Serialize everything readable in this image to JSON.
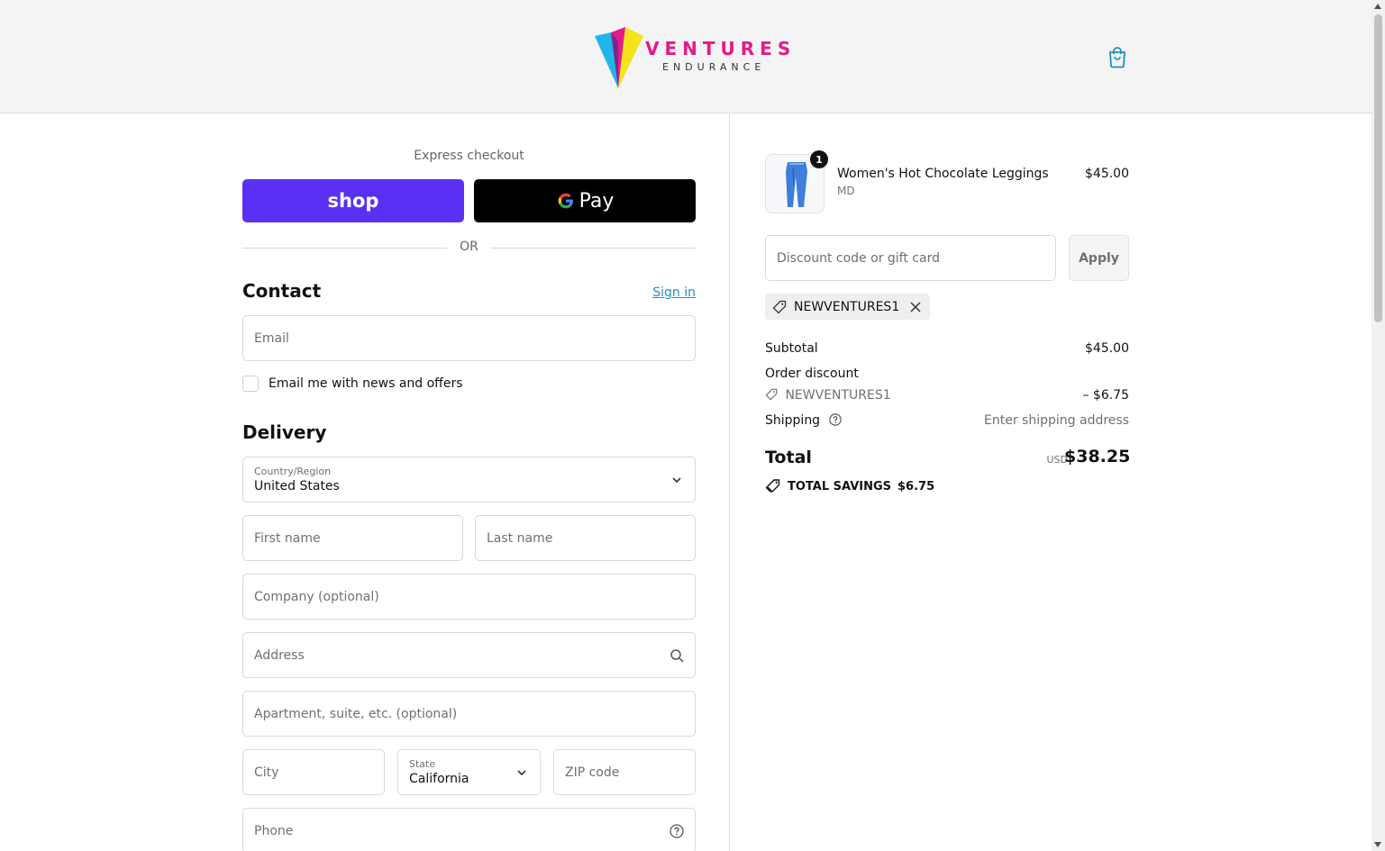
{
  "brand": {
    "name": "VENTURES",
    "tagline": "ENDURANCE",
    "colors": {
      "pink": "#e6198a",
      "yellow": "#f5e31a",
      "cyan": "#1fb6e8",
      "purple": "#5b2d90"
    }
  },
  "header": {
    "cart_icon": "shopping-bag-icon"
  },
  "express": {
    "label": "Express checkout",
    "shop_label": "shop",
    "gpay_label": "Pay",
    "or_label": "OR",
    "shop_color": "#5a31f4"
  },
  "contact": {
    "title": "Contact",
    "signin_label": "Sign in",
    "email_placeholder": "Email",
    "newsletter_label": "Email me with news and offers"
  },
  "delivery": {
    "title": "Delivery",
    "country_label": "Country/Region",
    "country_value": "United States",
    "first_name_placeholder": "First name",
    "last_name_placeholder": "Last name",
    "company_placeholder": "Company (optional)",
    "address_placeholder": "Address",
    "apartment_placeholder": "Apartment, suite, etc. (optional)",
    "city_placeholder": "City",
    "state_label": "State",
    "state_value": "California",
    "zip_placeholder": "ZIP code",
    "phone_placeholder": "Phone"
  },
  "order": {
    "item": {
      "quantity": "1",
      "name": "Women's Hot Chocolate Leggings",
      "variant": "MD",
      "price": "$45.00"
    },
    "discount_placeholder": "Discount code or gift card",
    "apply_label": "Apply",
    "applied_code": "NEWVENTURES1",
    "subtotal_label": "Subtotal",
    "subtotal_value": "$45.00",
    "order_discount_label": "Order discount",
    "discount_code": "NEWVENTURES1",
    "discount_value": "– $6.75",
    "shipping_label": "Shipping",
    "shipping_value": "Enter shipping address",
    "total_label": "Total",
    "total_currency": "USD",
    "total_value": "$38.25",
    "savings_label": "TOTAL SAVINGS",
    "savings_value": "$6.75"
  }
}
